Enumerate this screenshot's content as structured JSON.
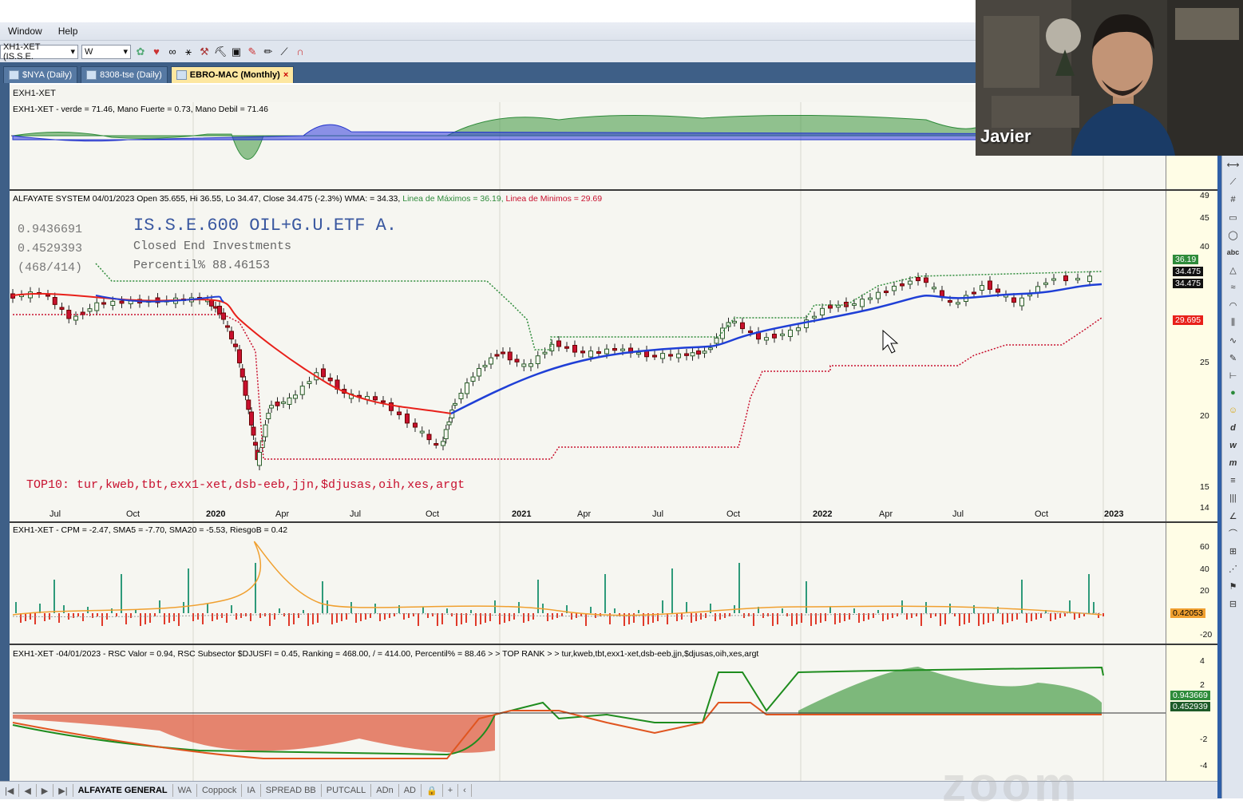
{
  "menu": {
    "items": [
      "Window",
      "Help"
    ]
  },
  "toolbar": {
    "symbol_combo": "XH1-XET (IS.S.E.",
    "period_combo": "W"
  },
  "tabs": [
    {
      "label": "$NYA (Daily)",
      "active": false
    },
    {
      "label": "8308-tse (Daily)",
      "active": false
    },
    {
      "label": "EBRO-MAC (Monthly)",
      "active": true
    }
  ],
  "chart": {
    "symbol_header": "EXH1-XET",
    "pane1_label": "EXH1-XET - verde = 71.46, Mano Fuerte = 0.73, Mano Debil = 71.46",
    "pane2_label_main": "ALFAYATE SYSTEM 04/01/2023 Open 35.655, Hi 36.55, Lo 34.47, Close 34.475 (-2.3%) WMA: = 34.33,",
    "pane2_label_max": "Linea de Máximos = 36.19,",
    "pane2_label_min": "Linea de Minimos = 29.69",
    "info_values": [
      "0.9436691",
      "0.4529393",
      "(468/414)"
    ],
    "info_title": "IS.S.E.600 OIL+G.U.ETF A.",
    "info_sector": "Closed End Investments",
    "info_percentil": "Percentil% 88.46153",
    "top10": "TOP10: tur,kweb,tbt,exx1-xet,dsb-eeb,jjn,$djusas,oih,xes,argt",
    "pane3_label": "EXH1-XET - CPM = -2.47, SMA5 = -7.70, SMA20 = -5.53, RiesgoB = 0.42",
    "pane4_label": "EXH1-XET -04/01/2023 - RSC Valor = 0.94, RSC Subsector $DJUSFI = 0.45, Ranking = 468.00, / = 414.00, Percentil% = 88.46 > > TOP RANK > > tur,kweb,tbt,exx1-xet,dsb-eeb,jjn,$djusas,oih,xes,argt",
    "date_labels": [
      "Jul",
      "Oct",
      "2020",
      "Apr",
      "Jul",
      "Oct",
      "2021",
      "Apr",
      "Jul",
      "Oct",
      "2022",
      "Apr",
      "Jul",
      "Oct",
      "2023"
    ],
    "price_scale": [
      "49",
      "45",
      "40",
      "25",
      "20",
      "15",
      "14"
    ],
    "price_tags": {
      "max": "36.19",
      "close1": "34.475",
      "close2": "34.475",
      "min": "29.695"
    },
    "pane3_scale": [
      "60",
      "40",
      "20",
      "-20"
    ],
    "pane3_tag": "0.42053",
    "pane4_scale": [
      "4",
      "2",
      "-2",
      "-4"
    ],
    "pane4_tags": [
      "0.943669",
      "0.452939"
    ]
  },
  "bottom_tabs": [
    "ALFAYATE GENERAL",
    "WA",
    "Coppock",
    "IA",
    "SPREAD BB",
    "PUTCALL",
    "ADn",
    "AD"
  ],
  "video": {
    "participant_name": "Javier"
  },
  "watermark": "zoom",
  "colors": {
    "up": "#2e8b3a",
    "down": "#c8102e",
    "wma": "#1f3fd6",
    "ema": "#e8201a",
    "accent_tab": "#fde7a0"
  }
}
